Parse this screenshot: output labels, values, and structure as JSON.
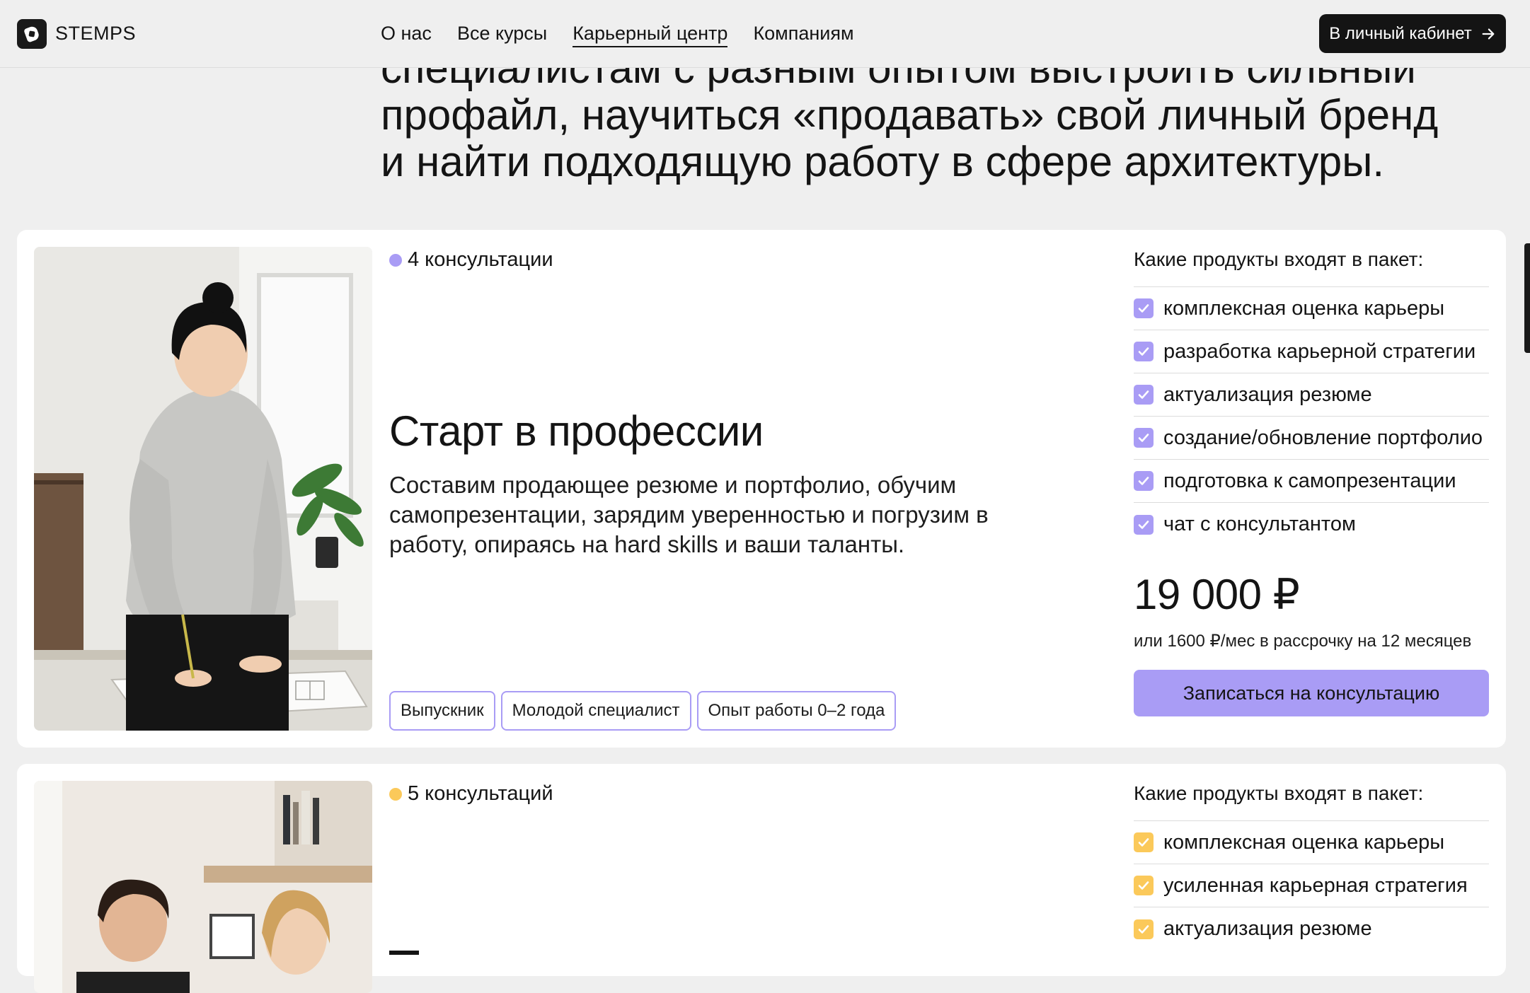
{
  "header": {
    "logo_text": "STEMPS",
    "nav": [
      "О нас",
      "Все курсы",
      "Карьерный центр",
      "Компаниям"
    ],
    "cabinet_button": "В личный кабинет"
  },
  "intro": {
    "text": "специалистам с разным опытом выстроить сильный профайл, научиться «продавать» свой личный бренд и найти подходящую работу в сфере архитектуры."
  },
  "colors": {
    "accent_purple": "#a99cf5",
    "accent_yellow": "#fbc95a",
    "dark": "#141414"
  },
  "packages": [
    {
      "count_label": "4 консультации",
      "dot_color": "#a99cf5",
      "title": "Старт в профессии",
      "description": "Составим продающее резюме и портфолио, обучим самопрезентации, зарядим уверенностью и погрузим в работу, опираясь на hard skills и ваши таланты.",
      "tags": [
        "Выпускник",
        "Молодой специалист",
        "Опыт работы 0–2 года"
      ],
      "products_heading": "Какие продукты входят в пакет:",
      "products": [
        "комплексная оценка карьеры",
        "разработка карьерной стратегии",
        "актуализация резюме",
        "создание/обновление портфолио",
        "подготовка к самопрезентации",
        "чат с консультантом"
      ],
      "price": "19 000 ₽",
      "installment": "или 1600 ₽/мес в рассрочку на 12 месяцев",
      "cta": "Записаться на консультацию"
    },
    {
      "count_label": "5 консультаций",
      "dot_color": "#fbc95a",
      "products_heading": "Какие продукты входят в пакет:",
      "products": [
        "комплексная оценка карьеры",
        "усиленная карьерная стратегия",
        "актуализация резюме"
      ]
    }
  ]
}
